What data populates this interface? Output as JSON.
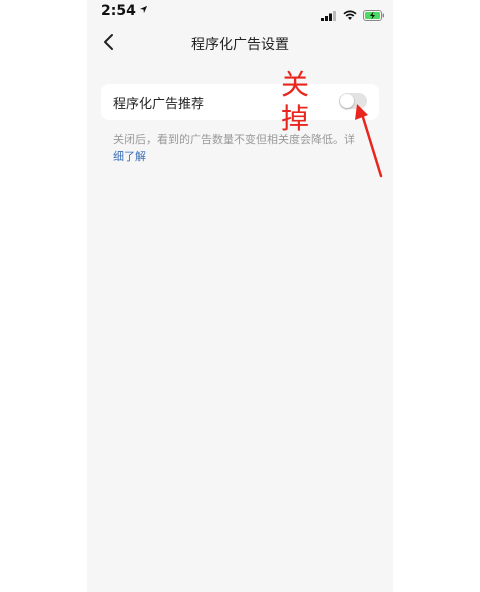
{
  "status_bar": {
    "time": "2:54",
    "location_icon": "location-arrow-icon",
    "signal_icon": "cellular-signal-icon",
    "wifi_icon": "wifi-icon",
    "battery_icon": "battery-charging-icon"
  },
  "nav": {
    "back_icon": "chevron-left-icon",
    "title": "程序化广告设置"
  },
  "setting": {
    "label": "程序化广告推荐",
    "toggle_on": false
  },
  "description": {
    "text": "关闭后，看到的广告数量不变但相关度会降低。详",
    "link": "细了解"
  },
  "annotation": {
    "line1": "关",
    "line2": "掉",
    "color": "#e8261e"
  }
}
